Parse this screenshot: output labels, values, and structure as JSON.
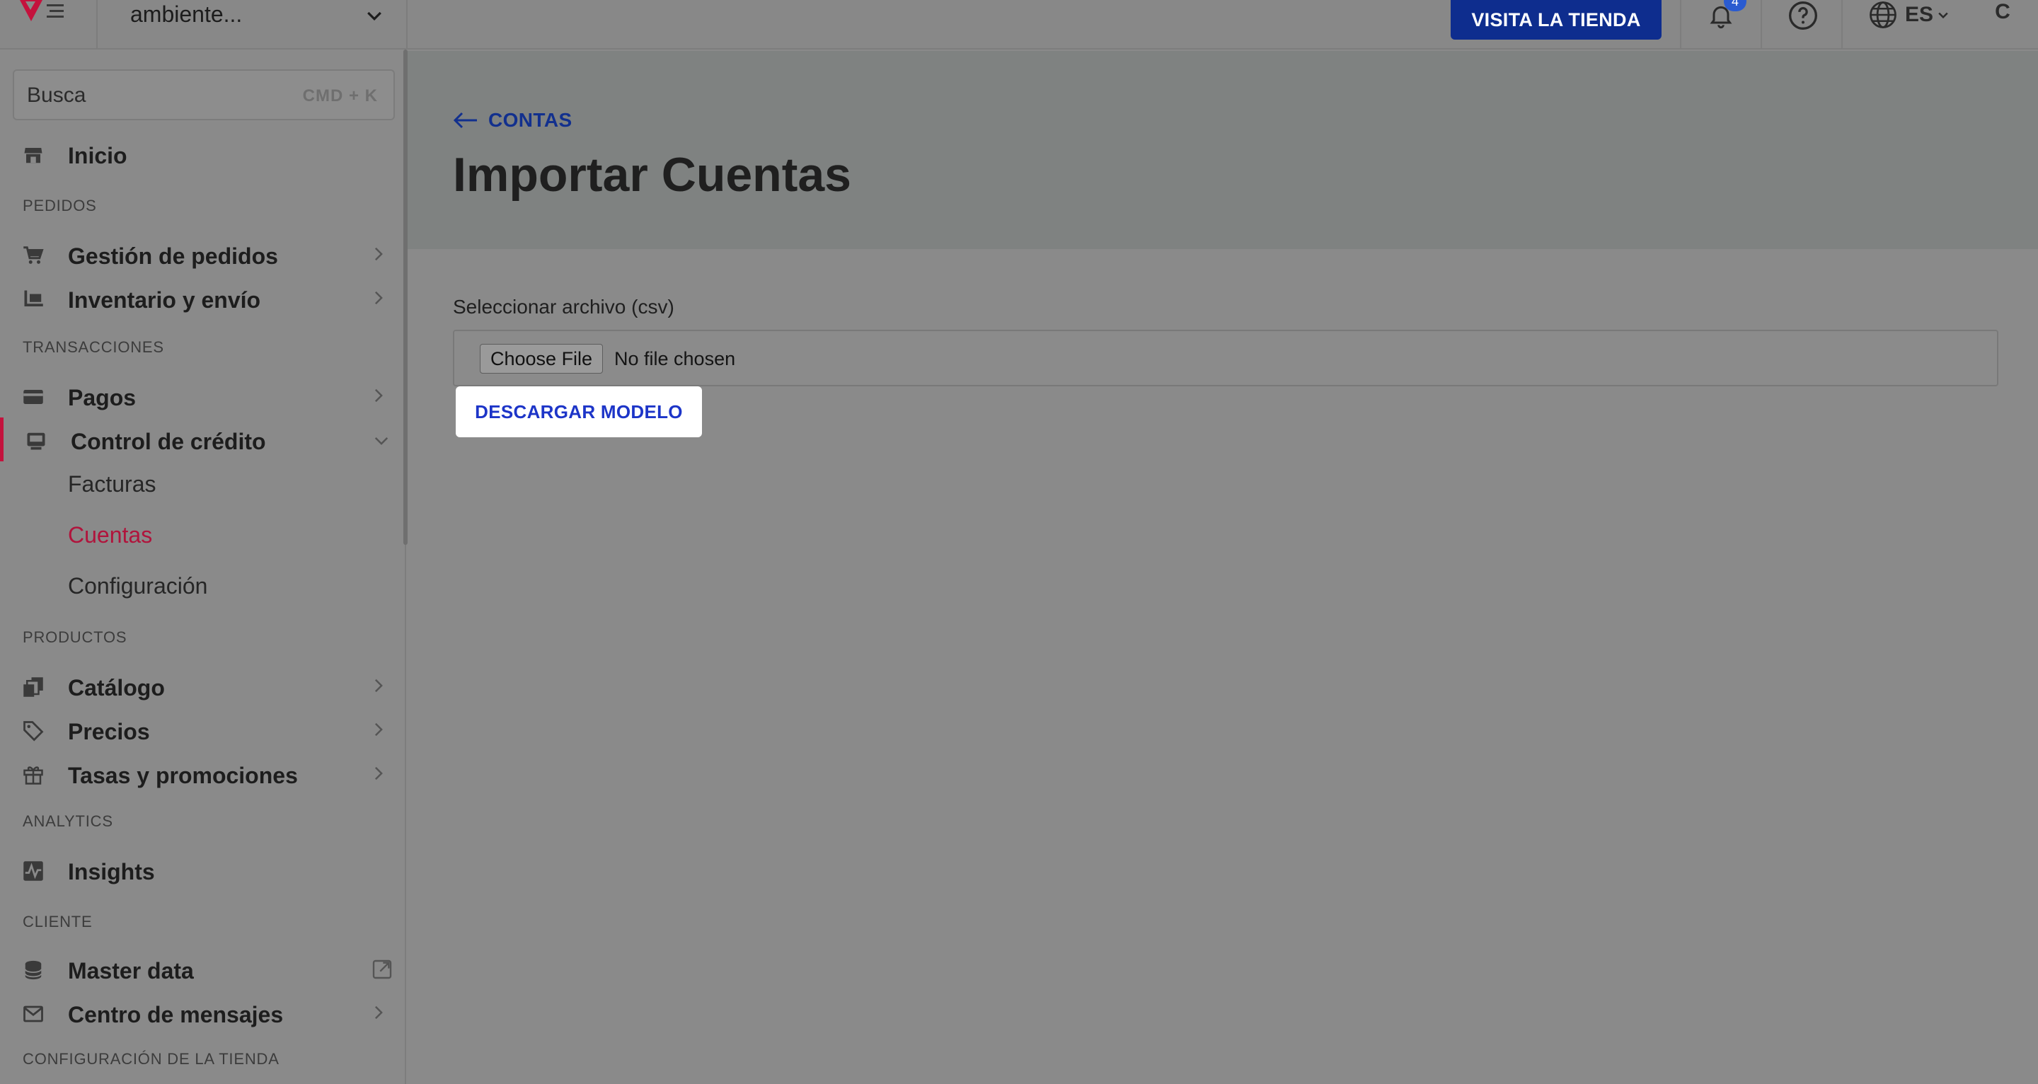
{
  "topbar": {
    "store_name": "ambiente...",
    "visit_store": "VISITA LA TIENDA",
    "notifications_count": "4",
    "language": "ES",
    "avatar_initial": "C"
  },
  "sidebar": {
    "search_placeholder": "Busca",
    "search_shortcut": "CMD + K",
    "home": "Inicio",
    "sections": {
      "orders": "PEDIDOS",
      "transactions": "TRANSACCIONES",
      "products": "PRODUCTOS",
      "analytics": "ANALYTICS",
      "customer": "CLIENTE",
      "store_settings": "CONFIGURACIÓN DE LA TIENDA"
    },
    "items": {
      "order_management": "Gestión de pedidos",
      "inventory": "Inventario y envío",
      "payments": "Pagos",
      "credit_control": "Control de crédito",
      "catalog": "Catálogo",
      "prices": "Precios",
      "promotions": "Tasas y promociones",
      "insights": "Insights",
      "master_data": "Master data",
      "message_center": "Centro de mensajes"
    },
    "credit_sub": {
      "invoices": "Facturas",
      "accounts": "Cuentas",
      "settings": "Configuración"
    }
  },
  "main": {
    "back_label": "CONTAS",
    "title": "Importar Cuentas",
    "file_label": "Seleccionar archivo (csv)",
    "choose_file": "Choose File",
    "no_file": "No file chosen",
    "download_template": "DESCARGAR MODELO"
  },
  "colors": {
    "accent": "#c4123d",
    "primary": "#0e2d8e",
    "overlay": "#8a8a8a"
  }
}
